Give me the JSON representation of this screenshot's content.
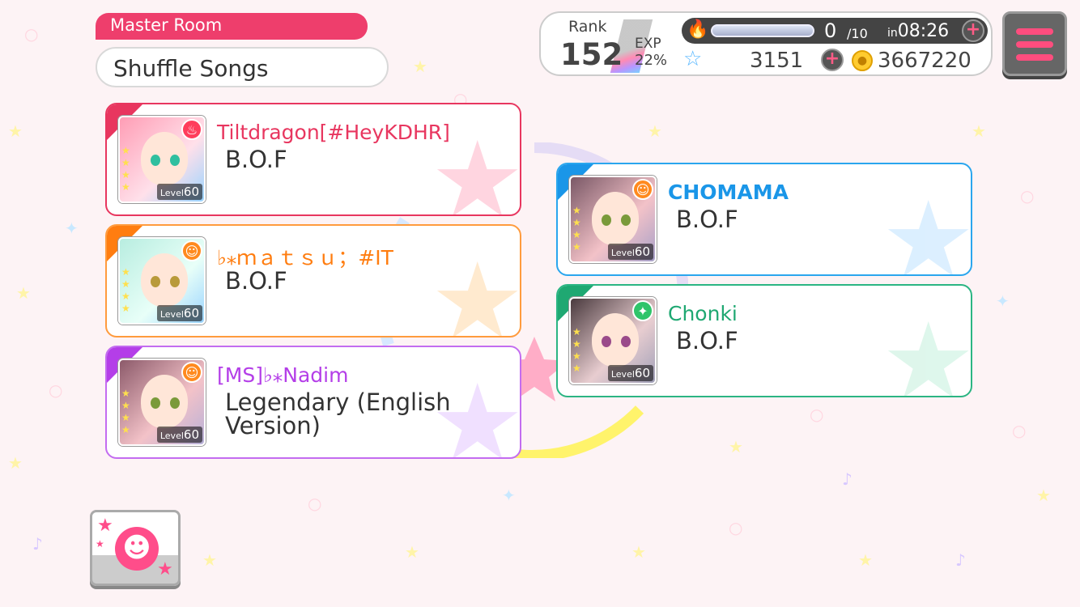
{
  "room": {
    "tag": "Master Room",
    "name": "Shuffle Songs"
  },
  "status": {
    "rank_label": "Rank",
    "rank": "152",
    "exp_label": "EXP",
    "exp_percent": "22%",
    "stamina": "0",
    "stamina_max": "/10",
    "timer_prefix": "in",
    "timer": "08:26",
    "stars": "3151",
    "coins": "3667220"
  },
  "players": [
    {
      "name": "Tiltdragon[#HeyKDHR]",
      "song": "B.O.F",
      "level_label": "Level",
      "level": "60",
      "color": "#e8365f",
      "attribute": "fire"
    },
    {
      "name": "♭⁎ｍａｔｓｕ；#IT",
      "song": "B.O.F",
      "level_label": "Level",
      "level": "60",
      "color": "#ff7d10",
      "attribute": "happy"
    },
    {
      "name": "[MS]♭⁎Nadim",
      "song": "Legendary (English Version)",
      "level_label": "Level",
      "level": "60",
      "color": "#b43ee8",
      "attribute": "happy"
    },
    {
      "name": "CHOMAMA",
      "song": "B.O.F",
      "level_label": "Level",
      "level": "60",
      "color": "#1a96e8",
      "attribute": "happy"
    },
    {
      "name": "Chonki",
      "song": "B.O.F",
      "level_label": "Level",
      "level": "60",
      "color": "#1fa872",
      "attribute": "pure"
    }
  ],
  "icons": {
    "fire": "fire-icon",
    "plus": "plus-icon",
    "star": "star-icon",
    "coin": "coin-icon",
    "menu": "menu-icon",
    "stamp": "smiley-stamp-icon"
  },
  "colors": {
    "accent": "#ee3e6c",
    "background": "#fdf3f5"
  }
}
